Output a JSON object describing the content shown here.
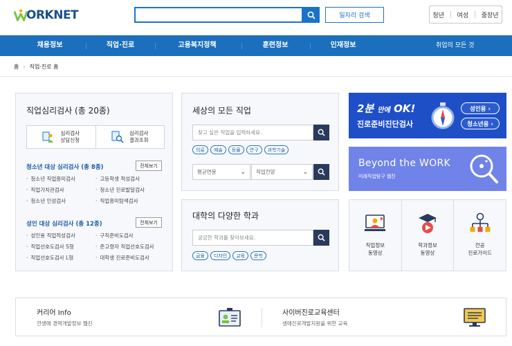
{
  "header": {
    "logo_text": "ORKNET",
    "search_placeholder": "",
    "job_search_label": "일자리 검색",
    "audience": [
      "청년",
      "여성",
      "중장년"
    ]
  },
  "nav": {
    "items": [
      "채용정보",
      "직업·진로",
      "고용복지정책",
      "훈련정보",
      "인재정보"
    ],
    "all_services": "취업의 모든 것"
  },
  "breadcrumb": [
    "홈",
    "직업·진로 홈"
  ],
  "psych_test": {
    "title": "직업심리검사 (총 20종)",
    "buttons": [
      {
        "line1": "심리검사",
        "line2": "상담신청"
      },
      {
        "line1": "심리검사",
        "line2": "결과조회"
      }
    ],
    "youth": {
      "title": "청소년 대상 심리검사 (총 8종)",
      "detail": "전체보기",
      "col1": [
        "청소년 직업흥미검사",
        "직업가치관검사",
        "청소년 인성검사"
      ],
      "col2": [
        "고등학생 적성검사",
        "청소년 진로발달검사",
        "직업흥미탐색검사"
      ]
    },
    "adult": {
      "title": "성인 대상 심리검사 (총 12종)",
      "detail": "전체보기",
      "col1": [
        "성인용 직업적성검사",
        "직업선호도검사 S형",
        "직업선호도검사 L형"
      ],
      "col2": [
        "구직준비도검사",
        "준고령자 직업선호도검사",
        "대학생 진로준비도검사"
      ]
    }
  },
  "jobs": {
    "title": "세상의 모든 직업",
    "placeholder": "찾고 싶은 직업을 입력하세요.",
    "tags": [
      "의료",
      "예술",
      "등물",
      "연구",
      "과학기술"
    ],
    "select1": "평균연봉",
    "select2": "직업전망"
  },
  "majors": {
    "title": "대학의 다양한 학과",
    "placeholder": "궁금한 학과를 찾아보세요.",
    "tags": [
      "금융",
      "디자인",
      "교육",
      "문학"
    ]
  },
  "banner1": {
    "line1_a": "2분",
    "line1_b": "만에",
    "line1_c": "OK!",
    "line2": "진로준비진단검사",
    "pill1": "성인용 ›",
    "pill2": "청소년용 ›"
  },
  "banner2": {
    "title": "Beyond the WORK",
    "sub": "미래직업탐구 웹진"
  },
  "tiles": [
    {
      "line1": "직업정보",
      "line2": "동영상"
    },
    {
      "line1": "학과정보",
      "line2": "동영상"
    },
    {
      "line1": "전공",
      "line2": "진로가이드"
    }
  ],
  "bottom": {
    "left_title": "커리어 Info",
    "left_sub": "전생애 경력개발정보 웹진",
    "right_title": "사이버진로교육센터",
    "right_sub": "생애진로개발지원을 위한 교육"
  },
  "colors": {
    "brand_blue": "#1b6fbd",
    "nav_bg": "#1b6fbd",
    "banner1_bg": "#1f4fc7",
    "banner2_bg": "#6f83e8",
    "search_dark": "#2a3a5c"
  }
}
